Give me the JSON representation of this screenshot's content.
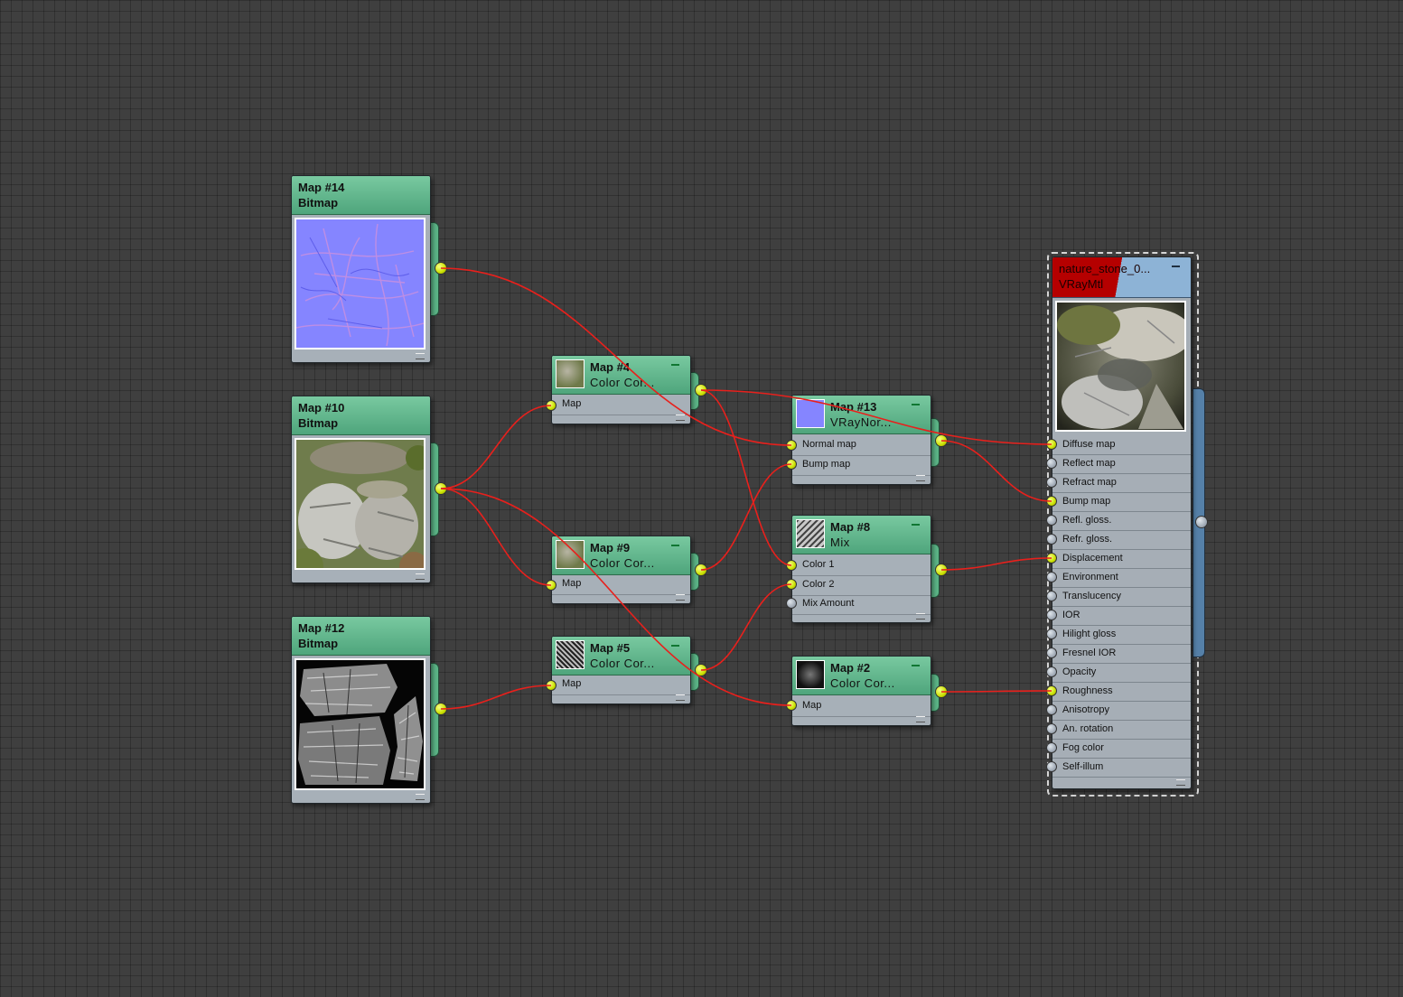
{
  "nodes": {
    "map14": {
      "title": "Map #14",
      "type": "Bitmap"
    },
    "map10": {
      "title": "Map #10",
      "type": "Bitmap"
    },
    "map12": {
      "title": "Map #12",
      "type": "Bitmap"
    },
    "map4": {
      "title": "Map #4",
      "type": "Color  Cor...",
      "slots": [
        "Map"
      ]
    },
    "map9": {
      "title": "Map #9",
      "type": "Color  Cor...",
      "slots": [
        "Map"
      ]
    },
    "map5": {
      "title": "Map #5",
      "type": "Color  Cor...",
      "slots": [
        "Map"
      ]
    },
    "map13": {
      "title": "Map #13",
      "type": "VRayNor...",
      "slots": [
        "Normal map",
        "Bump map"
      ]
    },
    "map8": {
      "title": "Map #8",
      "type": "Mix",
      "slots": [
        "Color 1",
        "Color 2",
        "Mix Amount"
      ]
    },
    "map2": {
      "title": "Map #2",
      "type": "Color  Cor...",
      "slots": [
        "Map"
      ]
    }
  },
  "material": {
    "title": "nature_stone_0...",
    "type": "VRayMtl",
    "slots": [
      "Diffuse map",
      "Reflect map",
      "Refract map",
      "Bump map",
      "Refl. gloss.",
      "Refr. gloss.",
      "Displacement",
      "Environment",
      "Translucency",
      "IOR",
      "Hilight gloss",
      "Fresnel IOR",
      "Opacity",
      "Roughness",
      "Anisotropy",
      "An. rotation",
      "Fog color",
      "Self-illum"
    ],
    "connected": [
      "Diffuse map",
      "Bump map",
      "Displacement",
      "Roughness"
    ]
  },
  "colors": {
    "wire": "#e8201c",
    "socket_on": "#d6f000",
    "node_header": "#5aae86",
    "material_header": "#b50000",
    "canvas": "#3f3f3f"
  }
}
